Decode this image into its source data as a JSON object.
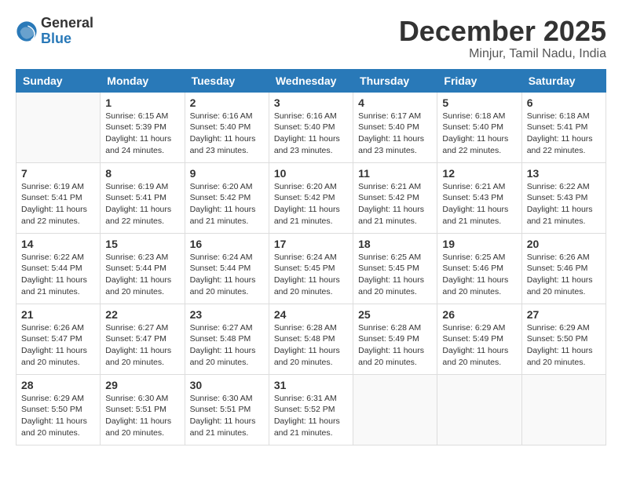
{
  "logo": {
    "general": "General",
    "blue": "Blue"
  },
  "title": "December 2025",
  "location": "Minjur, Tamil Nadu, India",
  "days_of_week": [
    "Sunday",
    "Monday",
    "Tuesday",
    "Wednesday",
    "Thursday",
    "Friday",
    "Saturday"
  ],
  "weeks": [
    [
      {
        "day": "",
        "info": ""
      },
      {
        "day": "1",
        "info": "Sunrise: 6:15 AM\nSunset: 5:39 PM\nDaylight: 11 hours\nand 24 minutes."
      },
      {
        "day": "2",
        "info": "Sunrise: 6:16 AM\nSunset: 5:40 PM\nDaylight: 11 hours\nand 23 minutes."
      },
      {
        "day": "3",
        "info": "Sunrise: 6:16 AM\nSunset: 5:40 PM\nDaylight: 11 hours\nand 23 minutes."
      },
      {
        "day": "4",
        "info": "Sunrise: 6:17 AM\nSunset: 5:40 PM\nDaylight: 11 hours\nand 23 minutes."
      },
      {
        "day": "5",
        "info": "Sunrise: 6:18 AM\nSunset: 5:40 PM\nDaylight: 11 hours\nand 22 minutes."
      },
      {
        "day": "6",
        "info": "Sunrise: 6:18 AM\nSunset: 5:41 PM\nDaylight: 11 hours\nand 22 minutes."
      }
    ],
    [
      {
        "day": "7",
        "info": "Sunrise: 6:19 AM\nSunset: 5:41 PM\nDaylight: 11 hours\nand 22 minutes."
      },
      {
        "day": "8",
        "info": "Sunrise: 6:19 AM\nSunset: 5:41 PM\nDaylight: 11 hours\nand 22 minutes."
      },
      {
        "day": "9",
        "info": "Sunrise: 6:20 AM\nSunset: 5:42 PM\nDaylight: 11 hours\nand 21 minutes."
      },
      {
        "day": "10",
        "info": "Sunrise: 6:20 AM\nSunset: 5:42 PM\nDaylight: 11 hours\nand 21 minutes."
      },
      {
        "day": "11",
        "info": "Sunrise: 6:21 AM\nSunset: 5:42 PM\nDaylight: 11 hours\nand 21 minutes."
      },
      {
        "day": "12",
        "info": "Sunrise: 6:21 AM\nSunset: 5:43 PM\nDaylight: 11 hours\nand 21 minutes."
      },
      {
        "day": "13",
        "info": "Sunrise: 6:22 AM\nSunset: 5:43 PM\nDaylight: 11 hours\nand 21 minutes."
      }
    ],
    [
      {
        "day": "14",
        "info": "Sunrise: 6:22 AM\nSunset: 5:44 PM\nDaylight: 11 hours\nand 21 minutes."
      },
      {
        "day": "15",
        "info": "Sunrise: 6:23 AM\nSunset: 5:44 PM\nDaylight: 11 hours\nand 20 minutes."
      },
      {
        "day": "16",
        "info": "Sunrise: 6:24 AM\nSunset: 5:44 PM\nDaylight: 11 hours\nand 20 minutes."
      },
      {
        "day": "17",
        "info": "Sunrise: 6:24 AM\nSunset: 5:45 PM\nDaylight: 11 hours\nand 20 minutes."
      },
      {
        "day": "18",
        "info": "Sunrise: 6:25 AM\nSunset: 5:45 PM\nDaylight: 11 hours\nand 20 minutes."
      },
      {
        "day": "19",
        "info": "Sunrise: 6:25 AM\nSunset: 5:46 PM\nDaylight: 11 hours\nand 20 minutes."
      },
      {
        "day": "20",
        "info": "Sunrise: 6:26 AM\nSunset: 5:46 PM\nDaylight: 11 hours\nand 20 minutes."
      }
    ],
    [
      {
        "day": "21",
        "info": "Sunrise: 6:26 AM\nSunset: 5:47 PM\nDaylight: 11 hours\nand 20 minutes."
      },
      {
        "day": "22",
        "info": "Sunrise: 6:27 AM\nSunset: 5:47 PM\nDaylight: 11 hours\nand 20 minutes."
      },
      {
        "day": "23",
        "info": "Sunrise: 6:27 AM\nSunset: 5:48 PM\nDaylight: 11 hours\nand 20 minutes."
      },
      {
        "day": "24",
        "info": "Sunrise: 6:28 AM\nSunset: 5:48 PM\nDaylight: 11 hours\nand 20 minutes."
      },
      {
        "day": "25",
        "info": "Sunrise: 6:28 AM\nSunset: 5:49 PM\nDaylight: 11 hours\nand 20 minutes."
      },
      {
        "day": "26",
        "info": "Sunrise: 6:29 AM\nSunset: 5:49 PM\nDaylight: 11 hours\nand 20 minutes."
      },
      {
        "day": "27",
        "info": "Sunrise: 6:29 AM\nSunset: 5:50 PM\nDaylight: 11 hours\nand 20 minutes."
      }
    ],
    [
      {
        "day": "28",
        "info": "Sunrise: 6:29 AM\nSunset: 5:50 PM\nDaylight: 11 hours\nand 20 minutes."
      },
      {
        "day": "29",
        "info": "Sunrise: 6:30 AM\nSunset: 5:51 PM\nDaylight: 11 hours\nand 20 minutes."
      },
      {
        "day": "30",
        "info": "Sunrise: 6:30 AM\nSunset: 5:51 PM\nDaylight: 11 hours\nand 21 minutes."
      },
      {
        "day": "31",
        "info": "Sunrise: 6:31 AM\nSunset: 5:52 PM\nDaylight: 11 hours\nand 21 minutes."
      },
      {
        "day": "",
        "info": ""
      },
      {
        "day": "",
        "info": ""
      },
      {
        "day": "",
        "info": ""
      }
    ]
  ]
}
